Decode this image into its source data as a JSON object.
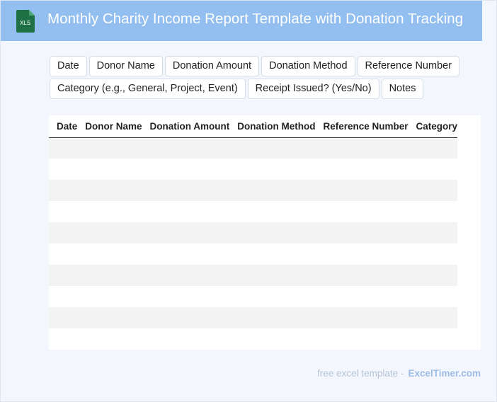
{
  "header": {
    "title": "Monthly Charity Income Report Template with Donation Tracking",
    "icon": "xls-file-icon",
    "icon_text": "XLS",
    "bg_color": "#92bff0"
  },
  "fields": [
    "Date",
    "Donor Name",
    "Donation Amount",
    "Donation Method",
    "Reference Number",
    "Category (e.g., General, Project, Event)",
    "Receipt Issued? (Yes/No)",
    "Notes"
  ],
  "table": {
    "columns": [
      "Date",
      "Donor Name",
      "Donation Amount",
      "Donation Method",
      "Reference Number",
      "Category"
    ],
    "empty_rows": 10
  },
  "footer": {
    "lead": "free excel template -",
    "brand": "ExcelTimer.com"
  }
}
